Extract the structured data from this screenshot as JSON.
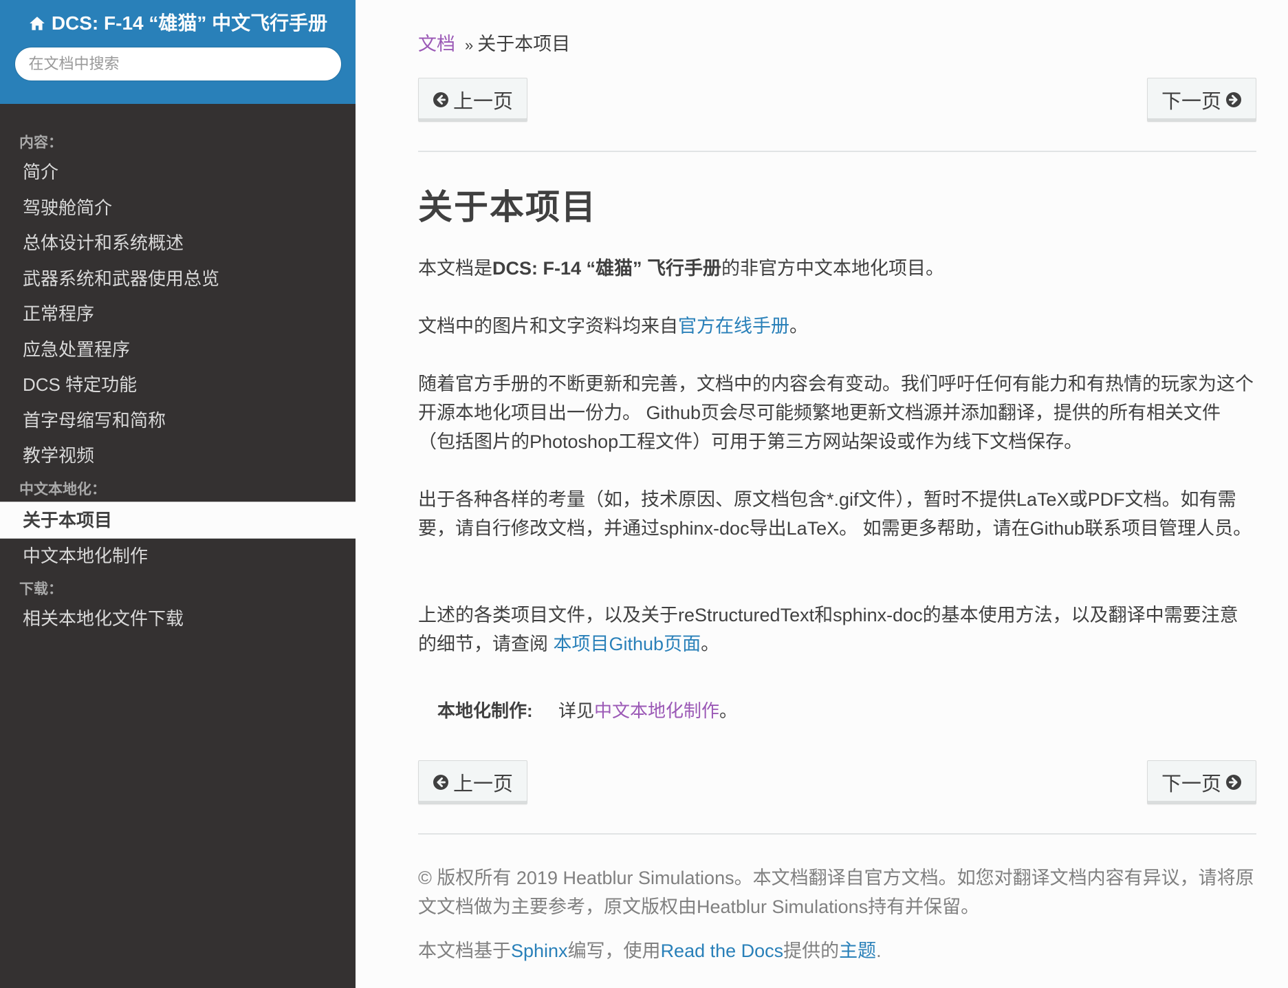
{
  "sidebar": {
    "title": "DCS: F-14 “雄猫” 中文飞行手册",
    "search_placeholder": "在文档中搜索",
    "captions": [
      "内容：",
      "中文本地化：",
      "下载："
    ],
    "contents_items": [
      "简介",
      "驾驶舱简介",
      "总体设计和系统概述",
      "武器系统和武器使用总览",
      "正常程序",
      "应急处置程序",
      "DCS 特定功能",
      "首字母缩写和简称",
      "教学视频"
    ],
    "localization_items": [
      "关于本项目",
      "中文本地化制作"
    ],
    "download_items": [
      "相关本地化文件下载"
    ]
  },
  "breadcrumb": {
    "root": "文档",
    "separator": "»",
    "current": "关于本项目"
  },
  "nav_buttons": {
    "prev": "上一页",
    "next": "下一页"
  },
  "page": {
    "title": "关于本项目",
    "p1_pre": "本文档是",
    "p1_bold": "DCS: F-14 “雄猫” 飞行手册",
    "p1_post": "的非官方中文本地化项目。",
    "p2_pre": "文档中的图片和文字资料均来自",
    "p2_link": "官方在线手册",
    "p2_post": "。",
    "p3": "随着官方手册的不断更新和完善，文档中的内容会有变动。我们呼吁任何有能力和有热情的玩家为这个开源本地化项目出一份力。 Github页会尽可能频繁地更新文档源并添加翻译，提供的所有相关文件（包括图片的Photoshop工程文件）可用于第三方网站架设或作为线下文档保存。",
    "p4": "出于各种各样的考量（如，技术原因、原文档包含*.gif文件），暂时不提供LaTeX或PDF文档。如有需要，请自行修改文档，并通过sphinx-doc导出LaTeX。 如需更多帮助，请在Github联系项目管理人员。",
    "p5_pre": "上述的各类项目文件，以及关于reStructuredText和sphinx-doc的基本使用方法，以及翻译中需要注意的细节，请查阅 ",
    "p5_link": "本项目Github页面",
    "p5_post": "。",
    "field_name": "本地化制作:",
    "field_pre": "详见",
    "field_link": "中文本地化制作",
    "field_post": "。"
  },
  "footer": {
    "copyright": "© 版权所有 2019 Heatblur Simulations。本文档翻译自官方文档。如您对翻译文档内容有异议，请将原文文档做为主要参考，原文版权由Heatblur Simulations持有并保留。",
    "built_pre": "本文档基于",
    "sphinx_link": "Sphinx",
    "built_mid": "编写，使用",
    "rtd_link": "Read the Docs",
    "built_mid2": "提供的",
    "theme_link": "主题",
    "built_post": "."
  },
  "colors": {
    "sidebar_head": "#2980b9",
    "sidebar_bg": "#343131",
    "link": "#2980b9",
    "visited_link": "#9b59b6",
    "text": "#404040"
  },
  "icons": [
    "home-icon",
    "arrow-circle-left-icon",
    "arrow-circle-right-icon"
  ]
}
